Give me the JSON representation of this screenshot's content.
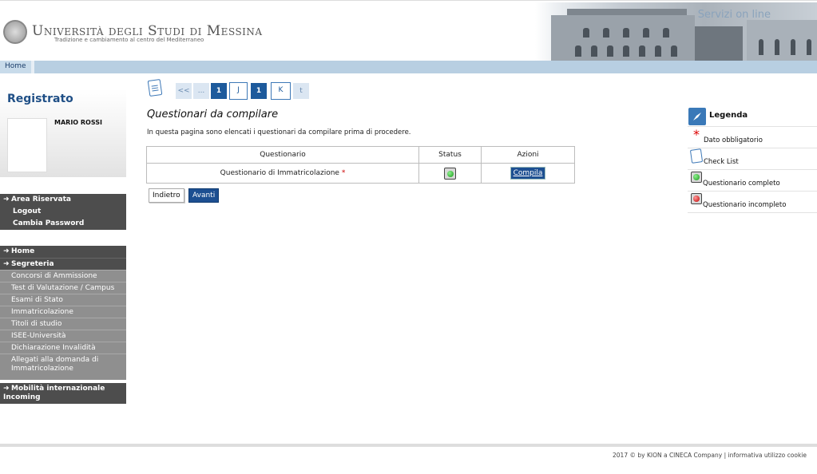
{
  "header": {
    "university_name": "Università degli Studi di Messina",
    "tagline": "Tradizione e cambiamento al centro del Mediterraneo",
    "banner_text": "Servizi on line"
  },
  "navbar": {
    "home_label": "Home"
  },
  "user_panel": {
    "title": "Registrato",
    "name": "MARIO ROSSI"
  },
  "account_menu": {
    "head": "Area Riservata",
    "items": [
      "Logout",
      "Cambia Password"
    ]
  },
  "main_menu": {
    "home": "Home",
    "segreteria": "Segreteria",
    "items": [
      "Concorsi di Ammissione",
      "Test di Valutazione / Campus",
      "Esami di Stato",
      "Immatricolazione",
      "Titoli di studio",
      "ISEE-Università",
      "Dichiarazione Invalidità",
      "Allegati alla domanda di Immatricolazione"
    ],
    "mobilita": "Mobilità internazionale Incoming"
  },
  "pager": {
    "items": [
      "<<",
      "...",
      "1",
      "J",
      "1",
      "K",
      "t"
    ]
  },
  "main": {
    "title": "Questionari da compilare",
    "intro": "In questa pagina sono elencati i questionari da compilare prima di procedere.",
    "table": {
      "headers": [
        "Questionario",
        "Status",
        "Azioni"
      ],
      "rows": [
        {
          "questionario": "Questionario di Immatricolazione",
          "required_mark": "*",
          "status": "completo",
          "action": "Compila"
        }
      ]
    },
    "btn_back": "Indietro",
    "btn_next": "Avanti"
  },
  "legend": {
    "title": "Legenda",
    "items": [
      {
        "icon": "required-star-icon",
        "label": "Dato obbligatorio"
      },
      {
        "icon": "checklist-icon",
        "label": "Check List"
      },
      {
        "icon": "status-complete-icon",
        "label": "Questionario completo"
      },
      {
        "icon": "status-incomplete-icon",
        "label": "Questionario incompleto"
      }
    ]
  },
  "footer": {
    "copyright": "2017 © by KION a CINECA Company",
    "separator": "|",
    "cookie_link": "informativa utilizzo cookie"
  },
  "colors": {
    "nav_blue": "#b8cfe2",
    "brand_blue": "#1d4f91",
    "sidebar_dark": "#4d4d4d",
    "sidebar_light": "#8f8f8f"
  }
}
